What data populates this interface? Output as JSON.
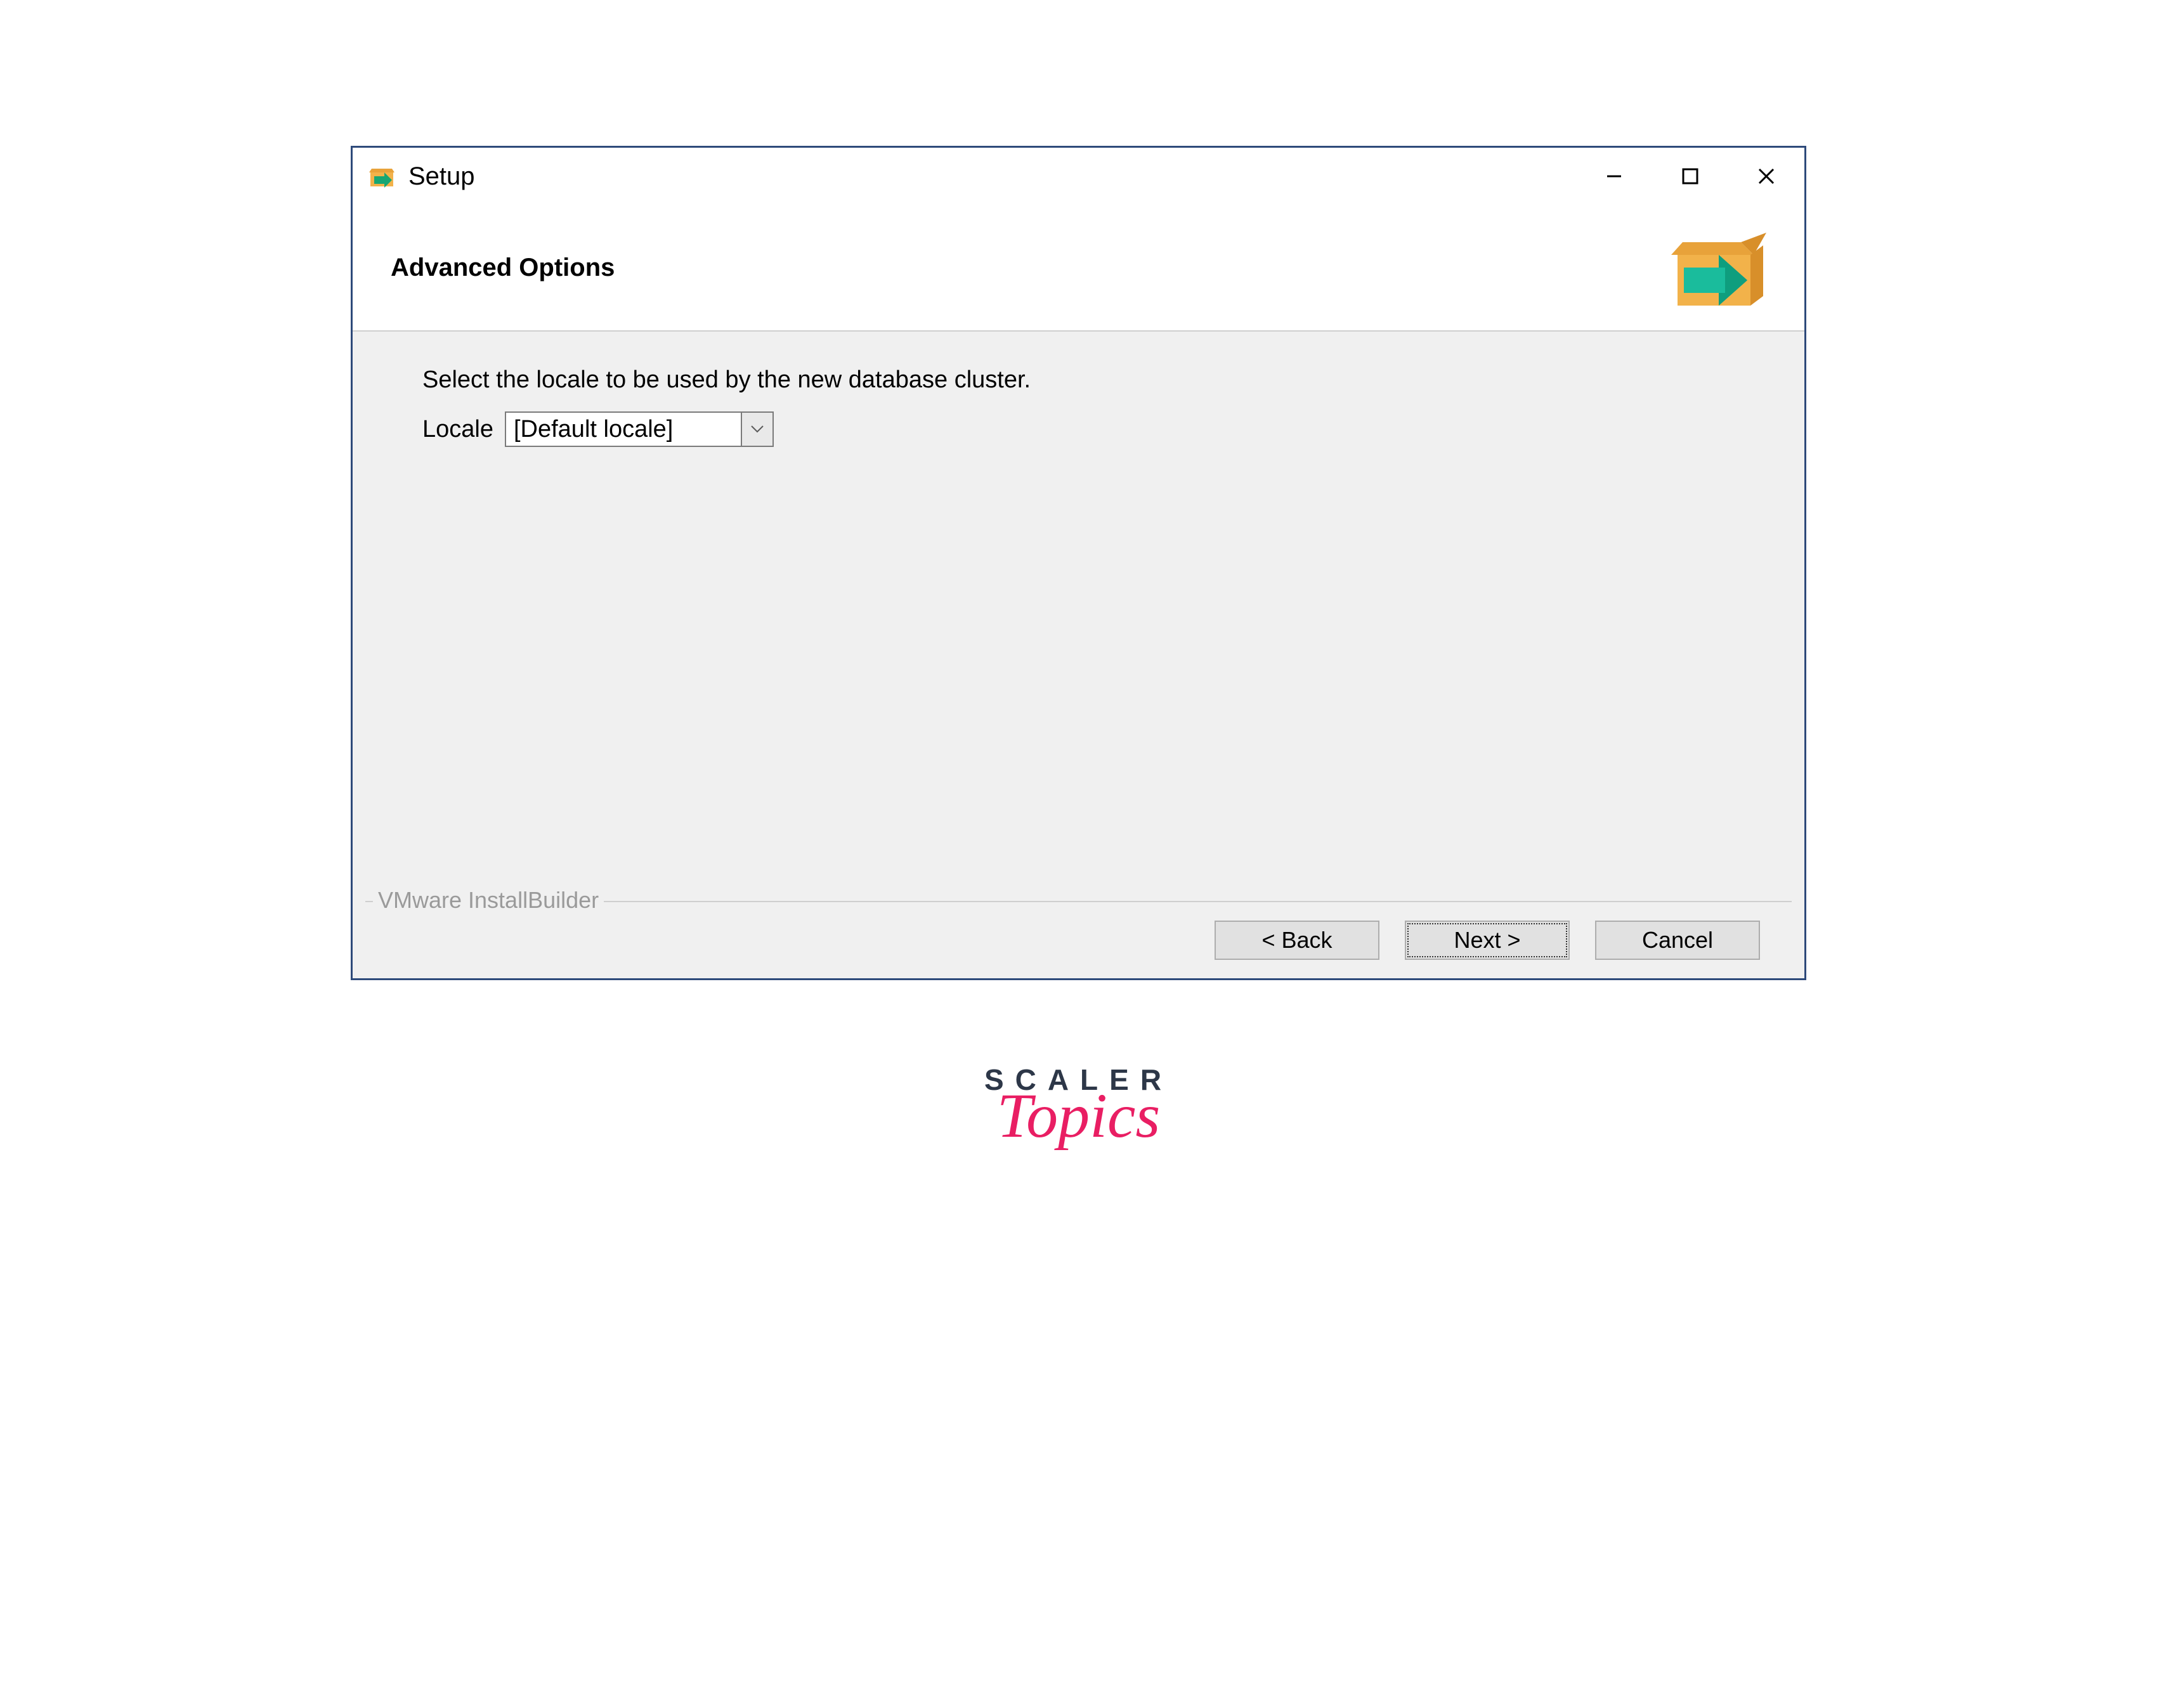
{
  "window": {
    "title": "Setup"
  },
  "header": {
    "title": "Advanced Options"
  },
  "content": {
    "instruction": "Select the locale to be used by the new database cluster.",
    "locale_label": "Locale",
    "locale_value": "[Default locale]"
  },
  "builder": {
    "label": "VMware InstallBuilder"
  },
  "footer": {
    "back": "< Back",
    "next": "Next >",
    "cancel": "Cancel"
  },
  "brand": {
    "top": "SCALER",
    "bottom": "Topics"
  }
}
